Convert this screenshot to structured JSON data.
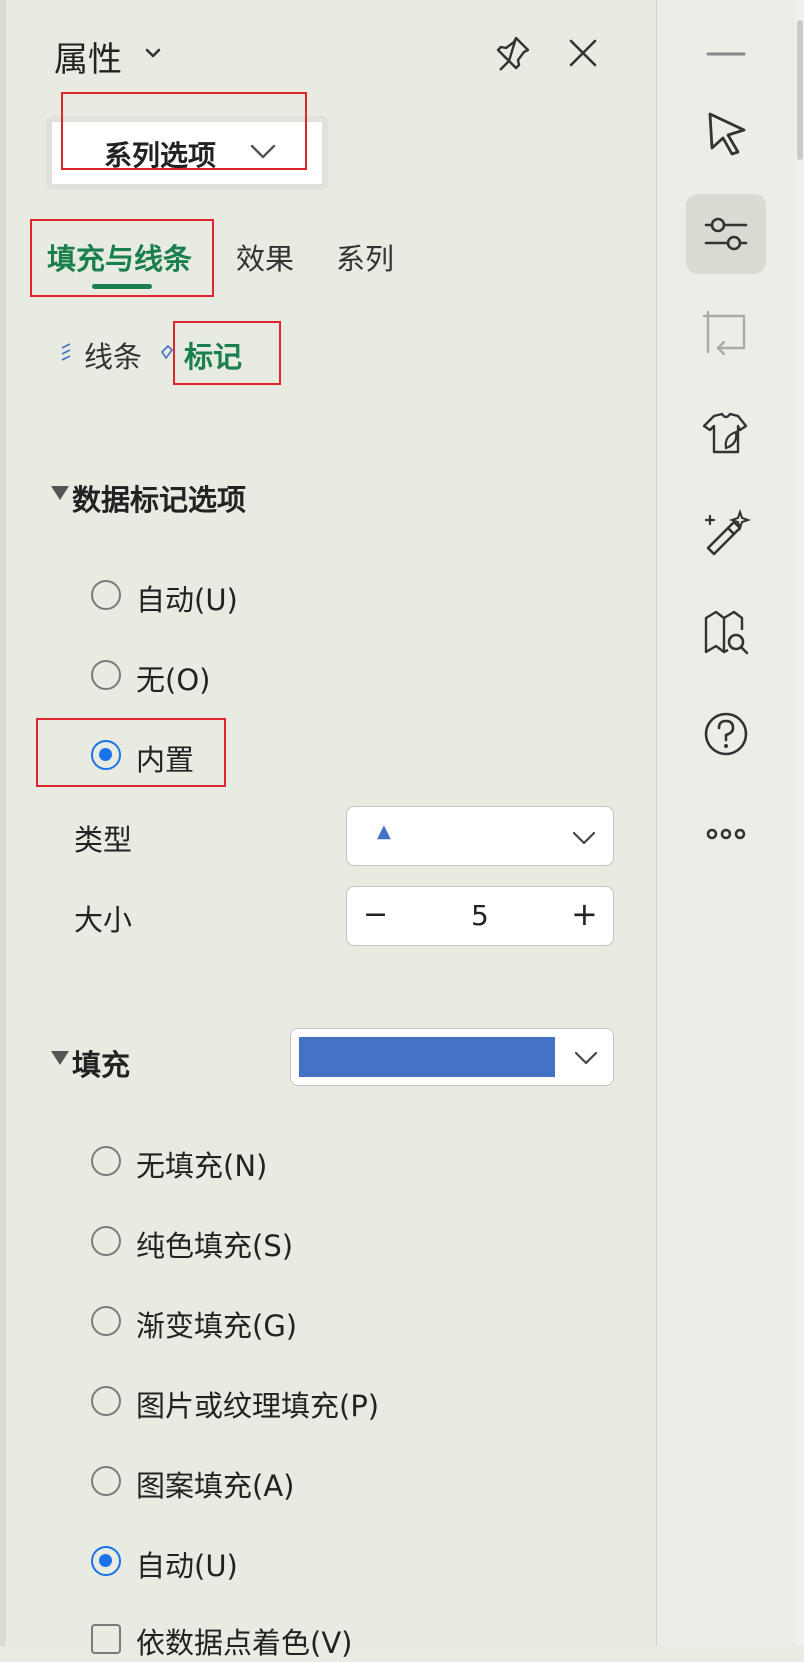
{
  "panel": {
    "title": "属性",
    "series_dropdown": "系列选项",
    "tabs": [
      {
        "label": "填充与线条",
        "active": true
      },
      {
        "label": "效果",
        "active": false
      },
      {
        "label": "系列",
        "active": false
      }
    ],
    "subtabs": [
      {
        "label": "线条",
        "active": false
      },
      {
        "label": "标记",
        "active": true
      }
    ],
    "marker_section": {
      "title": "数据标记选项",
      "options": [
        {
          "label": "自动(U)",
          "checked": false
        },
        {
          "label": "无(O)",
          "checked": false
        },
        {
          "label": "内置",
          "checked": true
        }
      ],
      "type_label": "类型",
      "type_value": "▲",
      "size_label": "大小",
      "size_value": "5",
      "minus": "−",
      "plus": "+"
    },
    "fill_section": {
      "title": "填充",
      "color": "#4472c4",
      "options": [
        {
          "label": "无填充(N)",
          "checked": false
        },
        {
          "label": "纯色填充(S)",
          "checked": false
        },
        {
          "label": "渐变填充(G)",
          "checked": false
        },
        {
          "label": "图片或纹理填充(P)",
          "checked": false
        },
        {
          "label": "图案填充(A)",
          "checked": false
        },
        {
          "label": "自动(U)",
          "checked": true
        }
      ],
      "vary_colors_label": "依数据点着色(V)"
    }
  },
  "rail": {
    "icons": [
      "minimize-icon",
      "select-cursor-icon",
      "properties-sliders-icon",
      "transform-icon",
      "style-icon",
      "magic-wand-icon",
      "book-search-icon",
      "help-icon",
      "more-icon"
    ],
    "active": "properties-sliders-icon"
  },
  "colors": {
    "accent": "#1a7f4c",
    "radio": "#1a73e8",
    "highlight": "#e1252f"
  }
}
